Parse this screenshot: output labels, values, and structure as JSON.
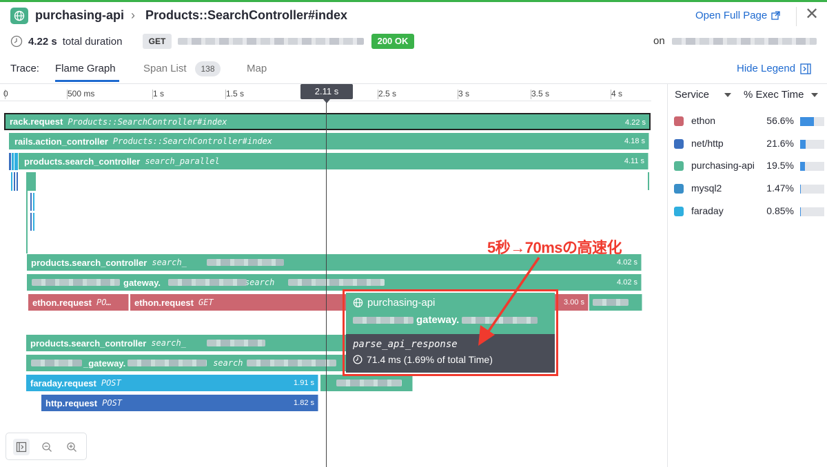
{
  "header": {
    "service_name": "purchasing-api",
    "resource": "Products::SearchController#index",
    "open_full_page": "Open Full Page",
    "duration_value": "4.22 s",
    "duration_label": "total duration",
    "method": "GET",
    "status": "200 OK",
    "on_label": "on"
  },
  "tabs": {
    "trace_label": "Trace:",
    "flame_graph": "Flame Graph",
    "span_list": "Span List",
    "span_count": "138",
    "map": "Map",
    "hide_legend": "Hide Legend"
  },
  "axis": {
    "ticks": [
      "0",
      "500 ms",
      "1 s",
      "1.5 s",
      "2.5 s",
      "3 s",
      "3.5 s",
      "4 s"
    ],
    "cursor": "2.11 s",
    "cursor_underlay": "2."
  },
  "spans": [
    {
      "name": "rack.request",
      "resource": "Products::SearchController#index",
      "duration": "4.22 s"
    },
    {
      "name": "rails.action_controller",
      "resource": "Products::SearchController#index",
      "duration": "4.18 s"
    },
    {
      "name": "products.search_controller",
      "resource": "search_parallel",
      "duration": "4.11 s"
    },
    {
      "name": "products.search_controller",
      "resource": "search_",
      "duration": "4.02 s"
    },
    {
      "name": "gateway.",
      "resource": "search",
      "duration": "4.02 s"
    },
    {
      "name": "ethon.request",
      "resource": "PO…",
      "duration": ""
    },
    {
      "name": "ethon.request",
      "resource": "GET",
      "duration": "3.00 s"
    },
    {
      "name": "products.search_controller",
      "resource": "search_",
      "duration": ""
    },
    {
      "name": "_gateway.",
      "resource": "search",
      "duration": ""
    },
    {
      "name": "faraday.request",
      "resource": "POST",
      "duration": "1.91 s"
    },
    {
      "name": "http.request",
      "resource": "POST",
      "duration": "1.82 s"
    }
  ],
  "tooltip": {
    "service": "purchasing-api",
    "operation": "gateway.",
    "resource": "parse_api_response",
    "time": "71.4 ms (1.69% of total Time)"
  },
  "annotation": "5秒→70msの高速化",
  "legend": {
    "col_service": "Service",
    "col_exec": "% Exec Time",
    "items": [
      {
        "name": "ethon",
        "pct": "56.6%",
        "fraction": 0.566,
        "color": "#cc6670"
      },
      {
        "name": "net/http",
        "pct": "21.6%",
        "fraction": 0.216,
        "color": "#3b6fbf"
      },
      {
        "name": "purchasing-api",
        "pct": "19.5%",
        "fraction": 0.195,
        "color": "#56b896"
      },
      {
        "name": "mysql2",
        "pct": "1.47%",
        "fraction": 0.0147,
        "color": "#3a8fc8"
      },
      {
        "name": "faraday",
        "pct": "0.85%",
        "fraction": 0.0085,
        "color": "#2fafdf"
      }
    ]
  },
  "icons": {
    "service": "globe-icon",
    "duration": "clock-icon",
    "open": "external-link-icon",
    "close": "close-icon",
    "legend": "collapse-panel-icon",
    "zoom": [
      "expand-panel-icon",
      "zoom-out-icon",
      "zoom-in-icon"
    ]
  }
}
